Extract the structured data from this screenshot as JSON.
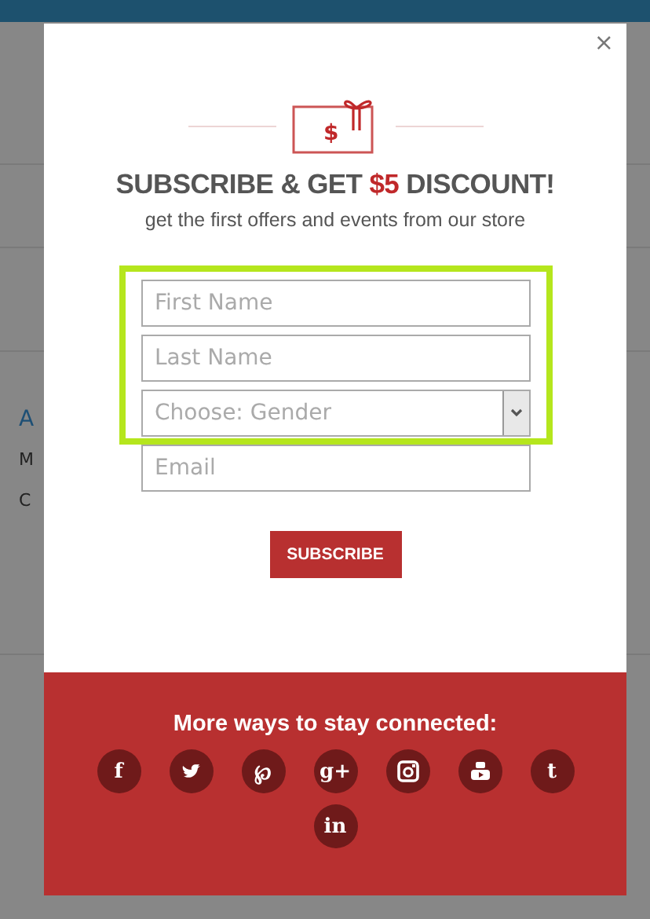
{
  "background": {
    "fragments": [
      {
        "kind": "link",
        "text": "A"
      },
      {
        "kind": "text",
        "text": "M"
      },
      {
        "kind": "text",
        "text": "C"
      }
    ]
  },
  "modal": {
    "close": "×",
    "heading_before": "SUBSCRIBE & GET ",
    "amount": "$5",
    "heading_after": " DISCOUNT!",
    "subtitle": "get the first offers and events from our store",
    "gift_symbol": "$",
    "highlighted_fields": [
      {
        "kind": "input",
        "placeholder": "First Name"
      },
      {
        "kind": "input",
        "placeholder": "Last Name"
      },
      {
        "kind": "select",
        "placeholder": "Choose: Gender"
      }
    ],
    "other_fields": [
      {
        "kind": "input",
        "placeholder": "Email"
      }
    ],
    "button": "SUBSCRIBE",
    "footer": {
      "title": "More ways to stay connected:",
      "icons": [
        {
          "kind": "glyph",
          "text": "f"
        },
        {
          "kind": "bird"
        },
        {
          "kind": "glyph",
          "text": "℘"
        },
        {
          "kind": "glyph",
          "text": "g+"
        },
        {
          "kind": "camera"
        },
        {
          "kind": "video"
        },
        {
          "kind": "glyph",
          "text": "t"
        },
        {
          "kind": "glyph",
          "text": "in"
        }
      ]
    }
  }
}
